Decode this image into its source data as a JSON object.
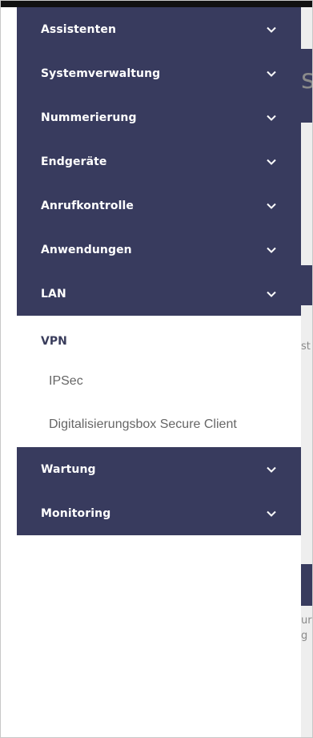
{
  "sidebar": {
    "items": [
      {
        "label": "Assistenten",
        "icon": "chevron-down-icon"
      },
      {
        "label": "Systemverwaltung",
        "icon": "chevron-down-icon"
      },
      {
        "label": "Nummerierung",
        "icon": "chevron-down-icon"
      },
      {
        "label": "Endgeräte",
        "icon": "chevron-down-icon"
      },
      {
        "label": "Anrufkontrolle",
        "icon": "chevron-down-icon"
      },
      {
        "label": "Anwendungen",
        "icon": "chevron-down-icon"
      },
      {
        "label": "LAN",
        "icon": "chevron-down-icon"
      }
    ],
    "expanded": {
      "label": "VPN",
      "children": [
        {
          "label": "IPSec"
        },
        {
          "label": "Digitalisierungsbox Secure Client"
        }
      ]
    },
    "bottom_items": [
      {
        "label": "Wartung",
        "icon": "chevron-down-icon"
      },
      {
        "label": "Monitoring",
        "icon": "chevron-down-icon"
      }
    ]
  },
  "background": {
    "fragments": [
      "sb",
      "st",
      "ur",
      "g"
    ]
  },
  "colors": {
    "nav_bg": "#383b5e",
    "nav_text": "#ffffff",
    "submenu_header": "#3a3d5c",
    "submenu_link": "#666666"
  }
}
